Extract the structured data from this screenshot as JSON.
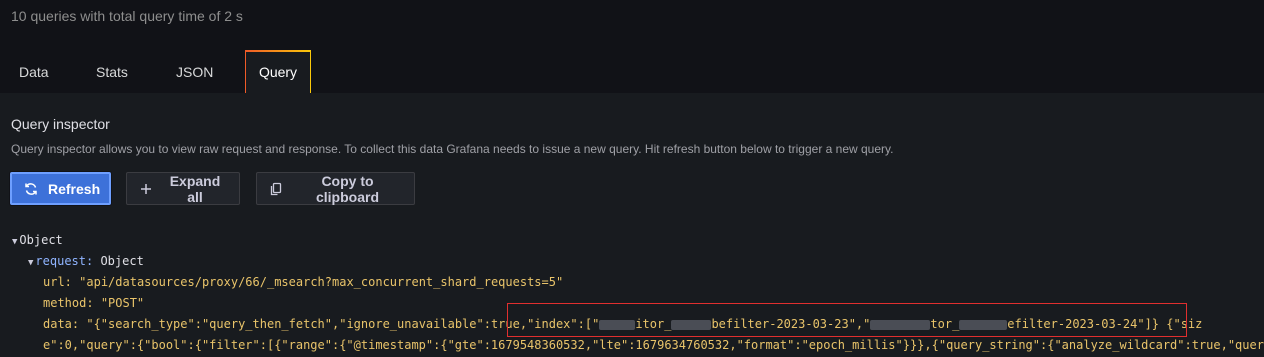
{
  "summary": "10 queries with total query time of 2 s",
  "tabs": [
    {
      "label": "Data"
    },
    {
      "label": "Stats"
    },
    {
      "label": "JSON"
    },
    {
      "label": "Query",
      "active": true
    }
  ],
  "inspector": {
    "title": "Query inspector",
    "description": "Query inspector allows you to view raw request and response. To collect this data Grafana needs to issue a new query. Hit refresh button below to trigger a new query."
  },
  "buttons": {
    "refresh": "Refresh",
    "expand_all": "Expand all",
    "copy": "Copy to clipboard"
  },
  "tree": {
    "root_label": "Object",
    "request_key": "request:",
    "request_type": "Object",
    "url_key": "url:",
    "url_value": "\"api/datasources/proxy/66/_msearch?max_concurrent_shard_requests=5\"",
    "method_key": "method:",
    "method_value": "\"POST\"",
    "data_key": "data:",
    "data_line1_a": "\"{\"search_type\":\"query_then_fetch\",\"ignore_unavailable\":true,",
    "data_line1_idx_a": "\"index\":[\"",
    "data_line1_idx_b": "itor_",
    "data_line1_idx_c": "befilter-2023-03-23\",\"",
    "data_line1_idx_d": "tor_",
    "data_line1_idx_e": "efilter-2023-03-24\"]}",
    "data_line1_end": "{\"siz",
    "data_line2": "e\":0,\"query\":{\"bool\":{\"filter\":[{\"range\":{\"@timestamp\":{\"gte\":1679548360532,\"lte\":1679634760532,\"format\":\"epoch_millis\"}}},{\"query_string\":{\"analyze_wildcard\":true,\"quer"
  },
  "colors": {
    "primary_button": "#3d71d9",
    "highlight_box": "#e02f2f",
    "active_tab_border": "#f05a28"
  }
}
